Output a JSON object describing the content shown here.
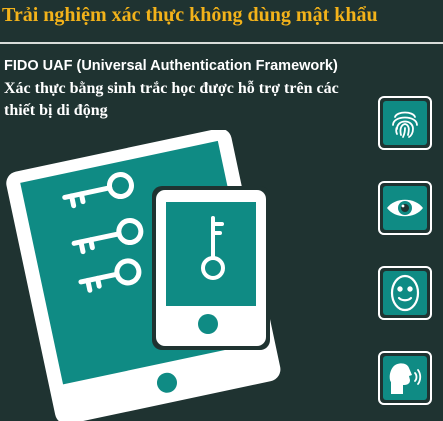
{
  "title": "Trải nghiệm xác thực không dùng mật khẩu",
  "subtitle": "FIDO UAF (Universal Authentication Framework)",
  "description": "Xác thực bằng sinh trắc học được hỗ trợ trên các thiết bị di động",
  "colors": {
    "title": "#f2b21a",
    "background": "#1f3331",
    "accent_teal": "#0f8b84",
    "white": "#ffffff"
  },
  "biometric_icons": [
    "fingerprint-icon",
    "eye-icon",
    "face-icon",
    "voice-icon"
  ]
}
